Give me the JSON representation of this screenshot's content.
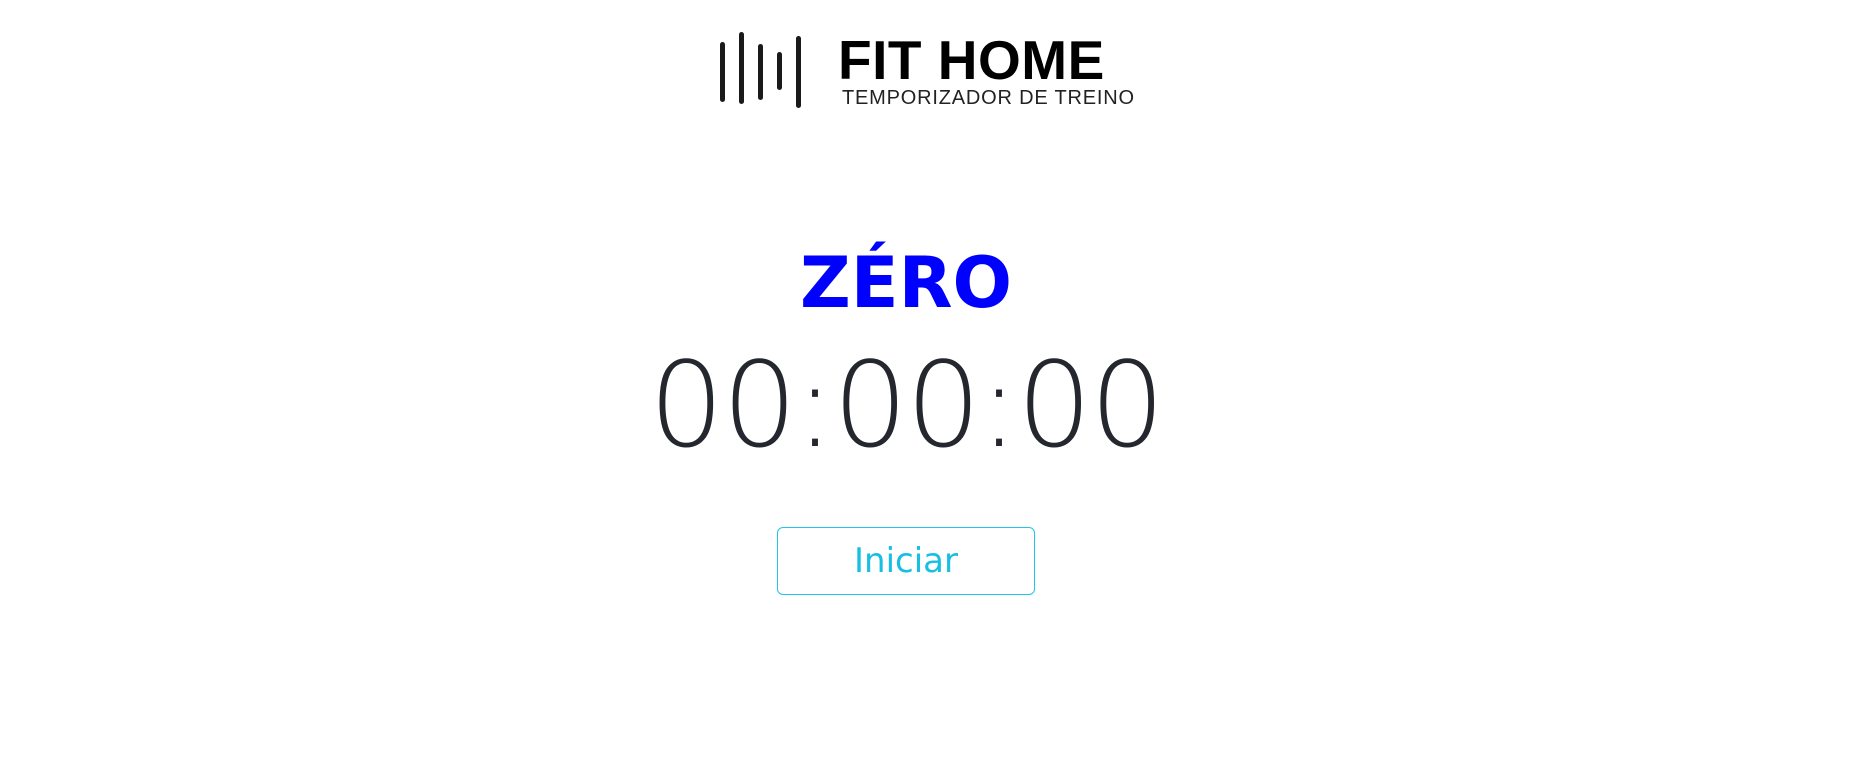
{
  "brand": {
    "title": "FIT HOME",
    "subtitle": "TEMPORIZADOR DE TREINO",
    "icon": "sound-wave-bars-icon"
  },
  "timer": {
    "mode": "ZÉRO",
    "display": "00:00:00",
    "mode_color": "#0000ff"
  },
  "controls": {
    "start_label": "Iniciar",
    "accent_color": "#17bfe3"
  }
}
